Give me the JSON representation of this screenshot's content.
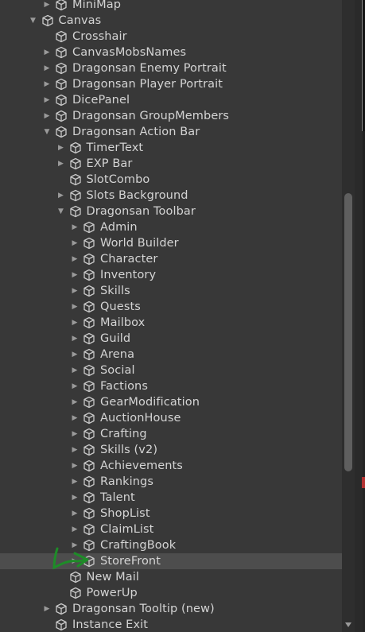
{
  "hierarchy": {
    "items": [
      {
        "label": "MiniMap",
        "depth": 2,
        "expander": "collapsed"
      },
      {
        "label": "Canvas",
        "depth": 1,
        "expander": "expanded"
      },
      {
        "label": "Crosshair",
        "depth": 2,
        "expander": "none"
      },
      {
        "label": "CanvasMobsNames",
        "depth": 2,
        "expander": "collapsed"
      },
      {
        "label": "Dragonsan Enemy Portrait",
        "depth": 2,
        "expander": "collapsed"
      },
      {
        "label": "Dragonsan Player Portrait",
        "depth": 2,
        "expander": "collapsed"
      },
      {
        "label": "DicePanel",
        "depth": 2,
        "expander": "collapsed"
      },
      {
        "label": "Dragonsan GroupMembers",
        "depth": 2,
        "expander": "collapsed"
      },
      {
        "label": "Dragonsan Action Bar",
        "depth": 2,
        "expander": "expanded"
      },
      {
        "label": "TimerText",
        "depth": 3,
        "expander": "collapsed"
      },
      {
        "label": "EXP Bar",
        "depth": 3,
        "expander": "collapsed"
      },
      {
        "label": "SlotCombo",
        "depth": 3,
        "expander": "none"
      },
      {
        "label": "Slots Background",
        "depth": 3,
        "expander": "collapsed"
      },
      {
        "label": "Dragonsan Toolbar",
        "depth": 3,
        "expander": "expanded"
      },
      {
        "label": "Admin",
        "depth": 4,
        "expander": "collapsed"
      },
      {
        "label": "World Builder",
        "depth": 4,
        "expander": "collapsed"
      },
      {
        "label": "Character",
        "depth": 4,
        "expander": "collapsed"
      },
      {
        "label": "Inventory",
        "depth": 4,
        "expander": "collapsed"
      },
      {
        "label": "Skills",
        "depth": 4,
        "expander": "collapsed"
      },
      {
        "label": "Quests",
        "depth": 4,
        "expander": "collapsed"
      },
      {
        "label": "Mailbox",
        "depth": 4,
        "expander": "collapsed"
      },
      {
        "label": "Guild",
        "depth": 4,
        "expander": "collapsed"
      },
      {
        "label": "Arena",
        "depth": 4,
        "expander": "collapsed"
      },
      {
        "label": "Social",
        "depth": 4,
        "expander": "collapsed"
      },
      {
        "label": "Factions",
        "depth": 4,
        "expander": "collapsed"
      },
      {
        "label": "GearModification",
        "depth": 4,
        "expander": "collapsed"
      },
      {
        "label": "AuctionHouse",
        "depth": 4,
        "expander": "collapsed"
      },
      {
        "label": "Crafting",
        "depth": 4,
        "expander": "collapsed"
      },
      {
        "label": "Skills (v2)",
        "depth": 4,
        "expander": "collapsed"
      },
      {
        "label": "Achievements",
        "depth": 4,
        "expander": "collapsed"
      },
      {
        "label": "Rankings",
        "depth": 4,
        "expander": "collapsed"
      },
      {
        "label": "Talent",
        "depth": 4,
        "expander": "collapsed"
      },
      {
        "label": "ShopList",
        "depth": 4,
        "expander": "collapsed"
      },
      {
        "label": "ClaimList",
        "depth": 4,
        "expander": "collapsed"
      },
      {
        "label": "CraftingBook",
        "depth": 4,
        "expander": "collapsed"
      },
      {
        "label": "StoreFront",
        "depth": 4,
        "expander": "collapsed",
        "selected": true
      },
      {
        "label": "New Mail",
        "depth": 3,
        "expander": "none"
      },
      {
        "label": "PowerUp",
        "depth": 3,
        "expander": "none"
      },
      {
        "label": "Dragonsan Tooltip (new)",
        "depth": 2,
        "expander": "collapsed"
      },
      {
        "label": "Instance Exit",
        "depth": 2,
        "expander": "none"
      }
    ]
  },
  "icons": {
    "gameobject": "cube-icon",
    "collapsed": "triangle-right-icon",
    "expanded": "triangle-down-icon"
  },
  "colors": {
    "background": "#383838",
    "selected_row": "#4d4d4d",
    "text": "#d4d4d4",
    "annotation": "#1e8c28"
  }
}
